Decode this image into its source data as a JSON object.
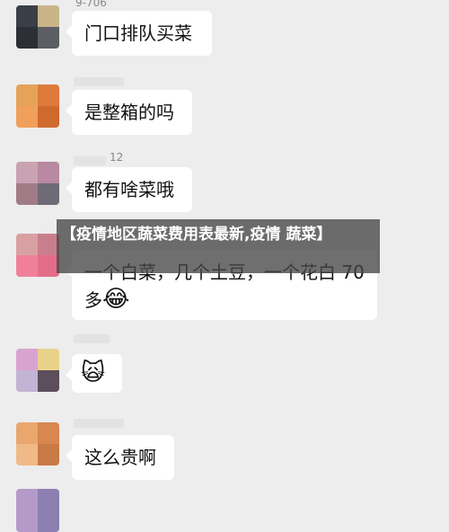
{
  "header_name": "9-706",
  "messages": [
    {
      "text": "门口排队买菜"
    },
    {
      "text": "是整箱的吗"
    },
    {
      "name_fragment": "12",
      "text": "都有啥菜哦"
    },
    {
      "text": "一个白菜，几个土豆，一个花白 70",
      "text2": "多",
      "emoji": "😂"
    },
    {
      "emoji": "🙀"
    },
    {
      "text": "这么贵啊"
    }
  ],
  "overlay": {
    "title": "【疫情地区蔬菜费用表最新,疫情 蔬菜】"
  }
}
